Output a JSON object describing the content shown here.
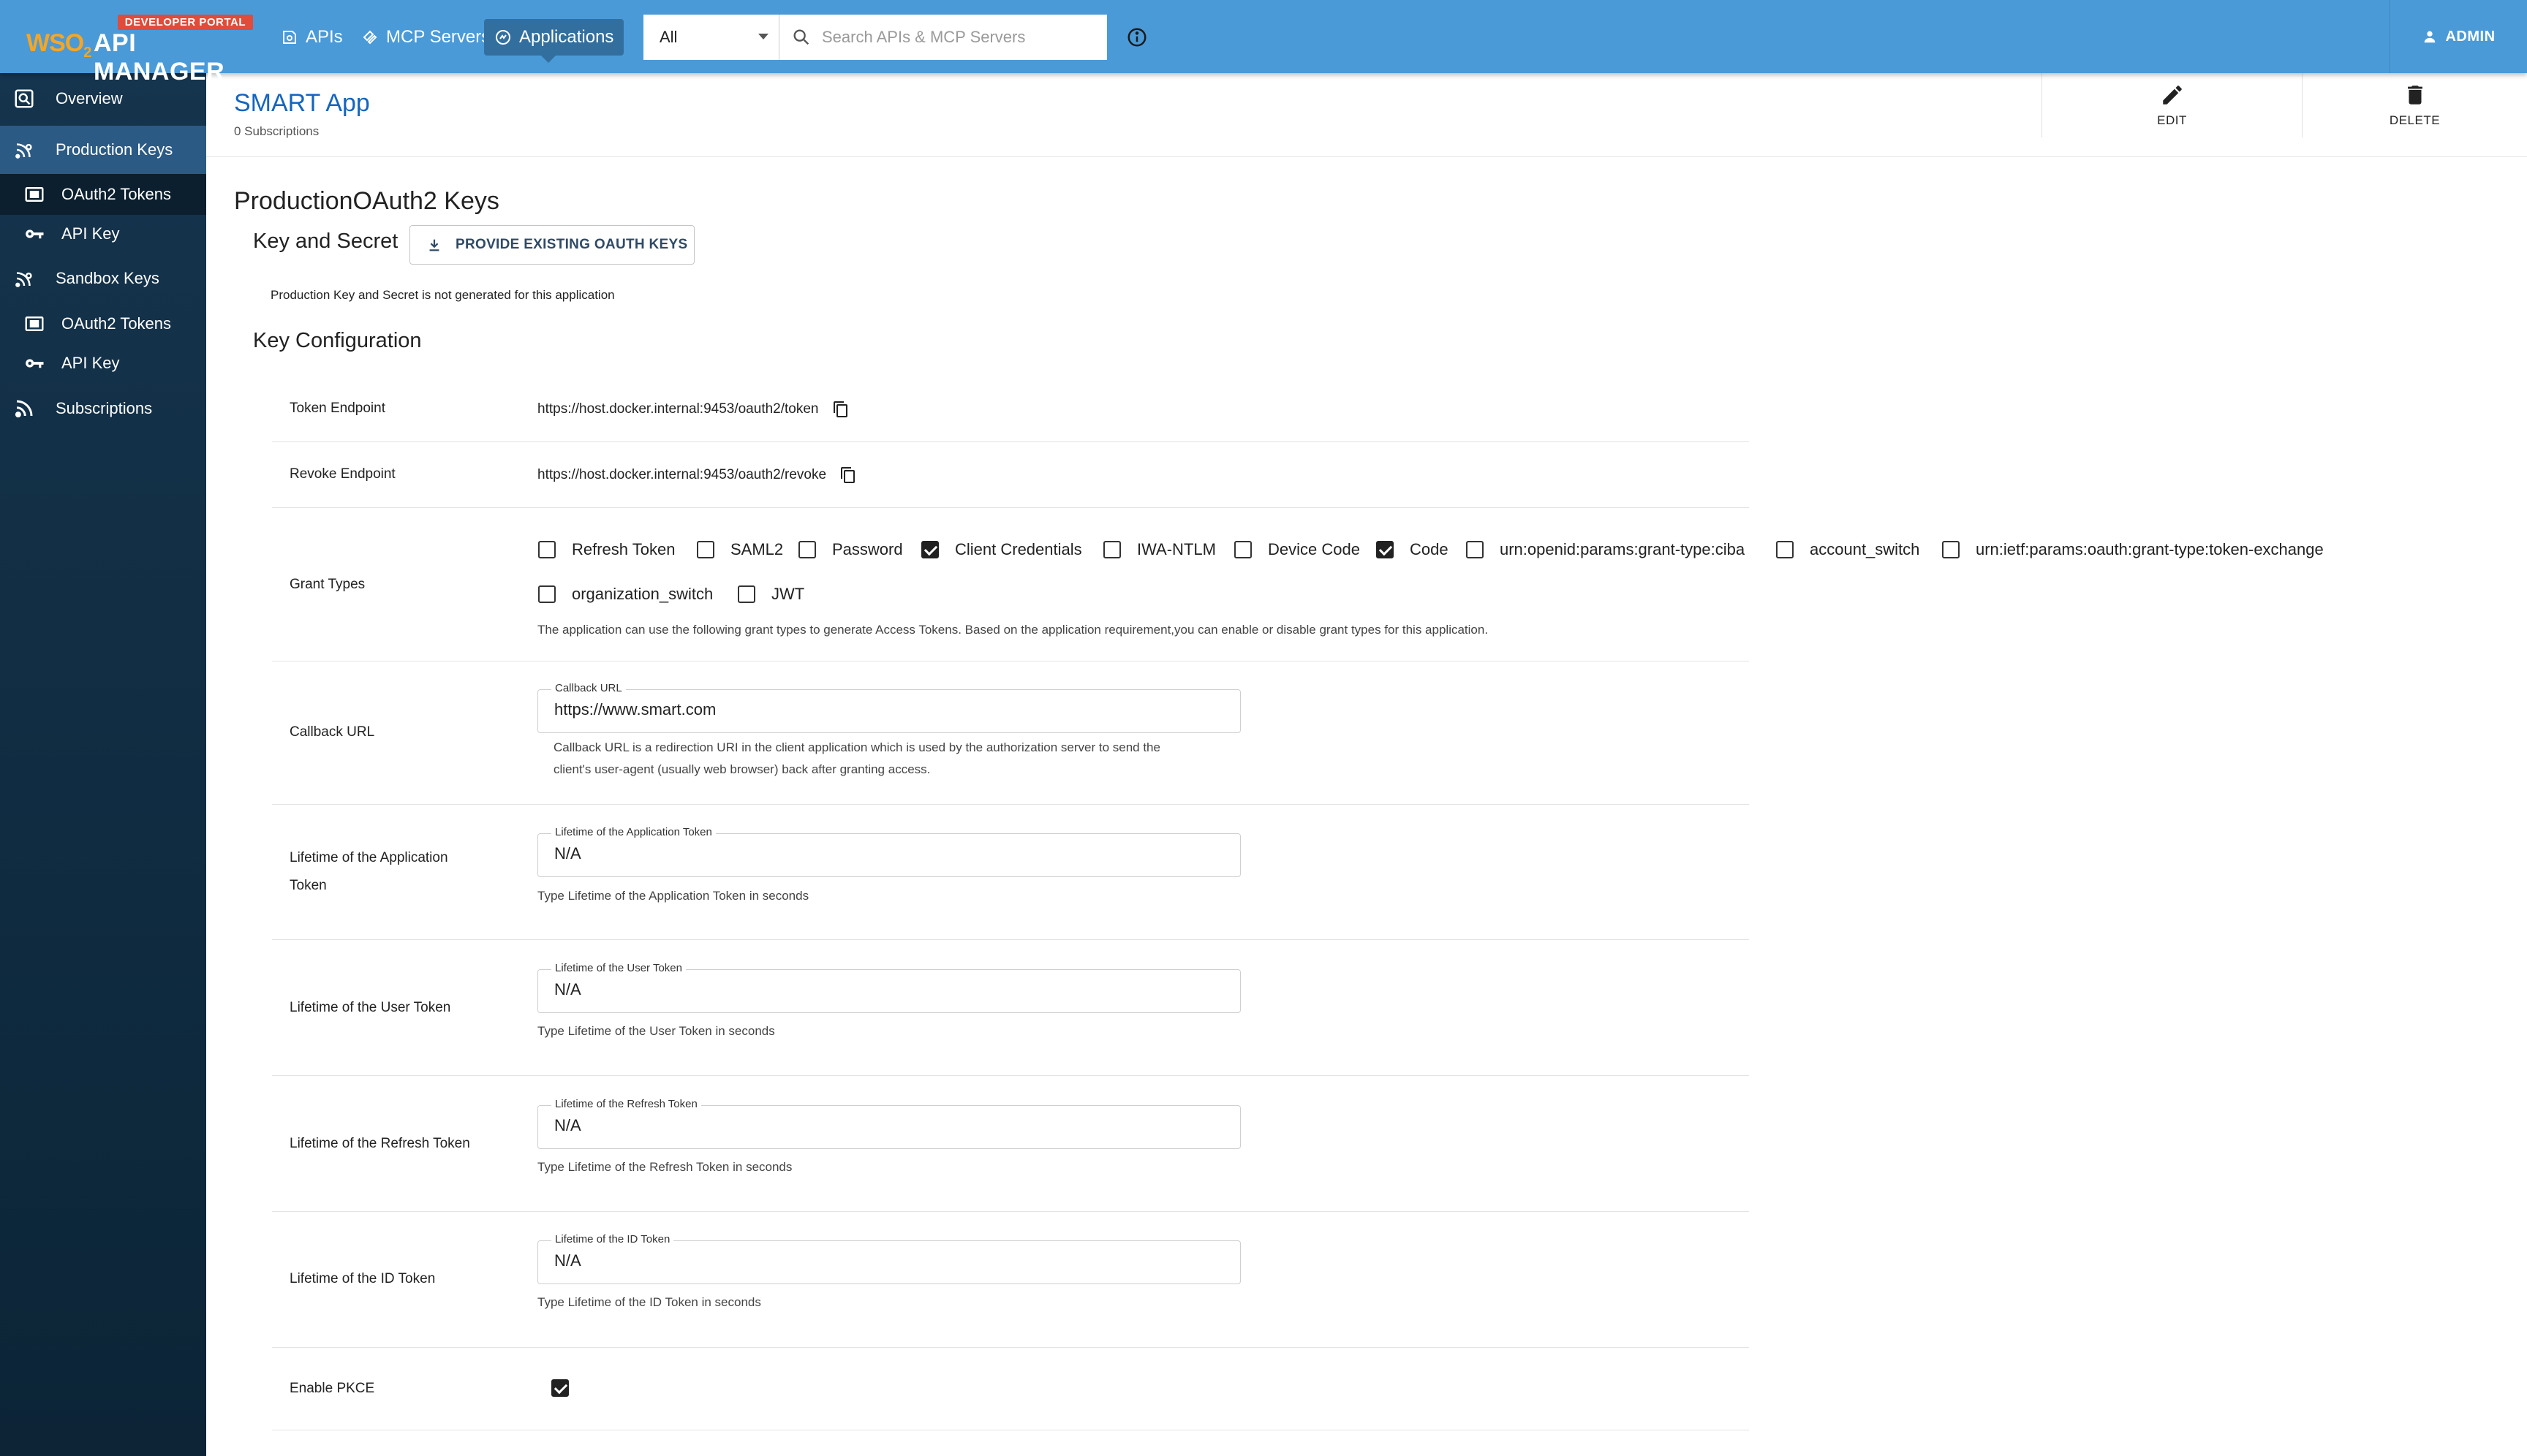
{
  "header": {
    "logo_badge": "DEVELOPER PORTAL",
    "logo_brand": "WSO",
    "logo_brand_sub": "2",
    "logo_text": "API MANAGER",
    "nav": [
      {
        "label": "APIs"
      },
      {
        "label": "MCP Servers"
      },
      {
        "label": "Applications"
      }
    ],
    "search_scope": "All",
    "search_placeholder": "Search APIs & MCP Servers",
    "user_label": "ADMIN"
  },
  "sidebar": {
    "items": [
      {
        "label": "Overview"
      },
      {
        "label": "Production Keys"
      },
      {
        "label": "OAuth2 Tokens"
      },
      {
        "label": "API Key"
      },
      {
        "label": "Sandbox Keys"
      },
      {
        "label": "OAuth2 Tokens"
      },
      {
        "label": "API Key"
      },
      {
        "label": "Subscriptions"
      }
    ]
  },
  "app": {
    "title": "SMART App",
    "subscriptions": "0 Subscriptions",
    "edit_label": "EDIT",
    "delete_label": "DELETE"
  },
  "keys": {
    "heading": "ProductionOAuth2 Keys",
    "key_secret_heading": "Key and Secret",
    "provide_button": "PROVIDE EXISTING OAUTH KEYS",
    "not_generated": "Production Key and Secret is not generated for this application",
    "config_heading": "Key Configuration"
  },
  "config": {
    "token_endpoint_label": "Token Endpoint",
    "token_endpoint": "https://host.docker.internal:9453/oauth2/token",
    "revoke_endpoint_label": "Revoke Endpoint",
    "revoke_endpoint": "https://host.docker.internal:9453/oauth2/revoke",
    "grant_types_label": "Grant Types",
    "grant_types": [
      {
        "label": "Refresh Token",
        "checked": false
      },
      {
        "label": "SAML2",
        "checked": false
      },
      {
        "label": "Password",
        "checked": false
      },
      {
        "label": "Client Credentials",
        "checked": true
      },
      {
        "label": "IWA-NTLM",
        "checked": false
      },
      {
        "label": "Device Code",
        "checked": false
      },
      {
        "label": "Code",
        "checked": true
      },
      {
        "label": "urn:openid:params:grant-type:ciba",
        "checked": false
      },
      {
        "label": "account_switch",
        "checked": false
      },
      {
        "label": "urn:ietf:params:oauth:grant-type:token-exchange",
        "checked": false
      },
      {
        "label": "organization_switch",
        "checked": false
      },
      {
        "label": "JWT",
        "checked": false
      }
    ],
    "grant_help": "The application can use the following grant types to generate Access Tokens. Based on the application requirement,you can enable or disable grant types for this application.",
    "callback_label": "Callback URL",
    "callback_field_label": "Callback URL",
    "callback_value": "https://www.smart.com",
    "callback_help_1": "Callback URL is a redirection URI in the client application which is used by the authorization server to send the",
    "callback_help_2": "client's user-agent (usually web browser) back after granting access.",
    "app_token_label_1": "Lifetime of the Application",
    "app_token_label_2": "Token",
    "app_token_field_label": "Lifetime of the Application Token",
    "app_token_value": "N/A",
    "app_token_help": "Type Lifetime of the Application Token in seconds",
    "user_token_label": "Lifetime of the User Token",
    "user_token_field_label": "Lifetime of the User Token",
    "user_token_value": "N/A",
    "user_token_help": "Type Lifetime of the User Token in seconds",
    "refresh_token_label": "Lifetime of the Refresh Token",
    "refresh_token_field_label": "Lifetime of the Refresh Token",
    "refresh_token_value": "N/A",
    "refresh_token_help": "Type Lifetime of the Refresh Token in seconds",
    "id_token_label": "Lifetime of the ID Token",
    "id_token_field_label": "Lifetime of the ID Token",
    "id_token_value": "N/A",
    "id_token_help": "Type Lifetime of the ID Token in seconds",
    "pkce_label": "Enable PKCE",
    "pkce_enabled": true
  },
  "colors": {
    "header_bg": "#4a9ad8",
    "nav_active_bg": "#336f9e",
    "sidebar_bg": "#15344d",
    "sidebar_active_bg": "#2b5a84",
    "title_blue": "#1565c0",
    "badge_red": "#e04b3a",
    "brand_orange": "#f5a623"
  }
}
